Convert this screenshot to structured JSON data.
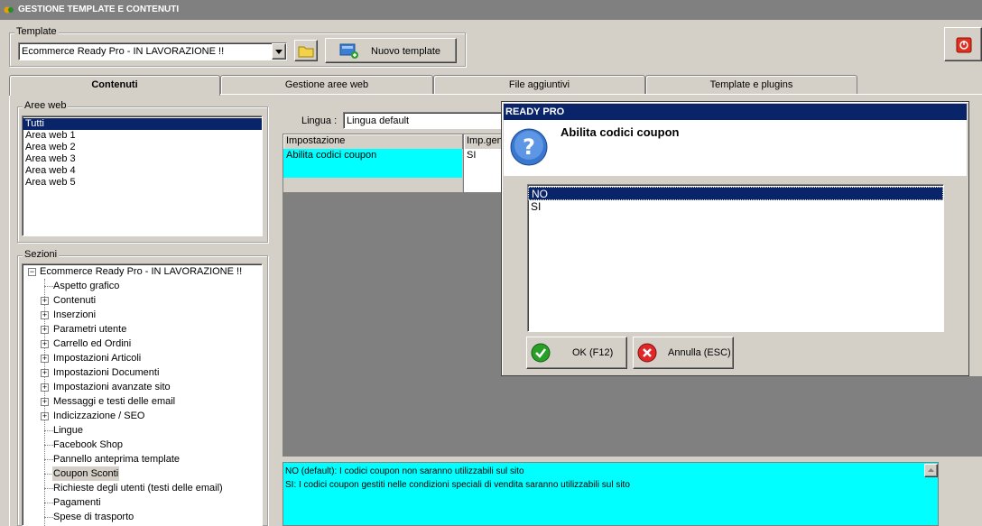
{
  "window": {
    "title": "GESTIONE TEMPLATE E CONTENUTI"
  },
  "template": {
    "group_label": "Template",
    "selected": "Ecommerce Ready Pro - IN LAVORAZIONE !!",
    "new_button": "Nuovo template"
  },
  "tabs": [
    "Contenuti",
    "Gestione aree web",
    "File aggiuntivi",
    "Template e plugins"
  ],
  "aree_web": {
    "label": "Aree web",
    "items": [
      "Tutti",
      "Area web 1",
      "Area web 2",
      "Area web 3",
      "Area web 4",
      "Area web 5"
    ]
  },
  "sezioni": {
    "label": "Sezioni",
    "root": "Ecommerce Ready Pro - IN LAVORAZIONE !!",
    "items": [
      "Aspetto grafico",
      "Contenuti",
      "Inserzioni",
      "Parametri utente",
      "Carrello ed Ordini",
      "Impostazioni Articoli",
      "Impostazioni Documenti",
      "Impostazioni avanzate sito",
      "Messaggi e testi delle email",
      "Indicizzazione / SEO",
      "Lingue",
      "Facebook Shop",
      "Pannello anteprima template",
      "Coupon Sconti",
      "Richieste degli utenti (testi delle email)",
      "Pagamenti",
      "Spese di trasporto"
    ]
  },
  "lingua": {
    "label": "Lingua :",
    "value": "Lingua default"
  },
  "grid": {
    "headers": [
      "Impostazione",
      "Imp.gen"
    ],
    "rows": [
      {
        "setting": "Abilita codici coupon",
        "value": "SI"
      }
    ]
  },
  "description": {
    "line1": "NO (default): I codici coupon non saranno utilizzabili sul sito",
    "line2": "SI: I codici coupon gestiti nelle condizioni speciali di vendita saranno utilizzabili sul sito"
  },
  "dialog": {
    "title": "READY PRO",
    "question": "Abilita codici coupon",
    "options": [
      "NO",
      "SI"
    ],
    "ok": "OK (F12)",
    "cancel": "Annulla (ESC)"
  },
  "colors": {
    "highlight": "#00ffff",
    "selection": "#0a246a",
    "title_bar": "#0a246a"
  }
}
